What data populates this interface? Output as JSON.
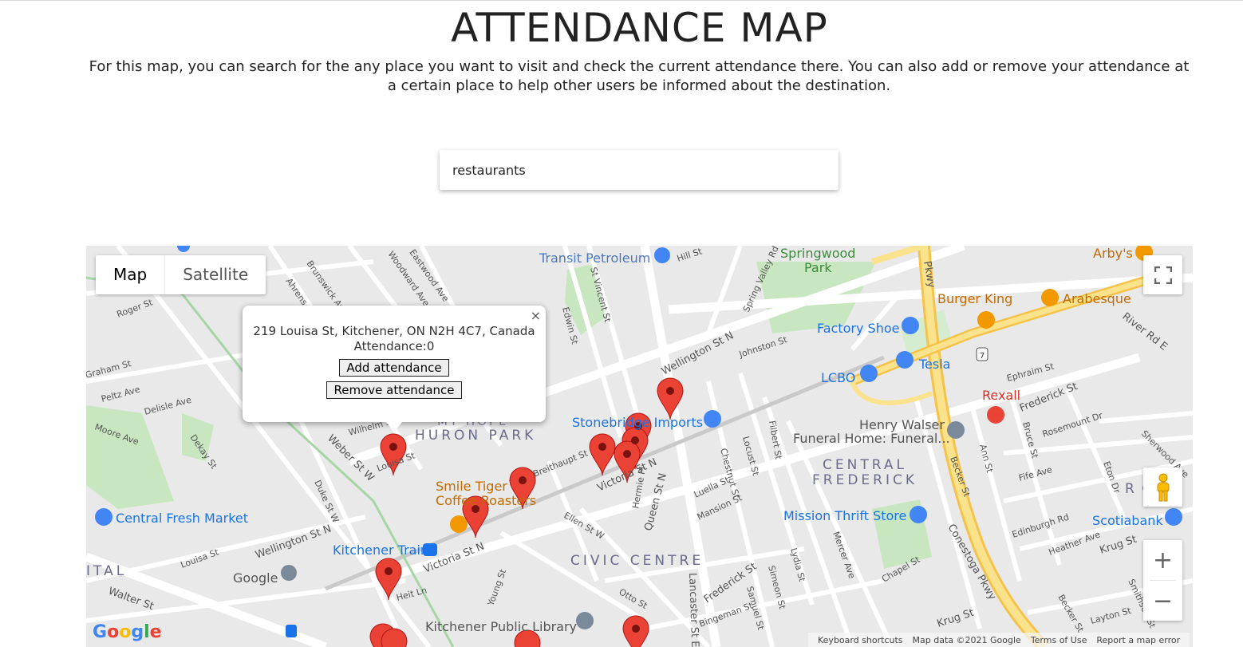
{
  "page": {
    "title": "ATTENDANCE MAP",
    "intro": "For this map, you can search for the any place you want to visit and check the current attendance there. You can also add or remove your attendance at a certain place to help other users be informed about the destination."
  },
  "search": {
    "value": "restaurants"
  },
  "map": {
    "type_control": {
      "map": "Map",
      "satellite": "Satellite"
    },
    "zoom": {
      "in": "+",
      "out": "−"
    },
    "infowindow": {
      "address": "219 Louisa St, Kitchener, ON N2H 4C7, Canada",
      "attendance": "Attendance:0",
      "add_button": "Add attendance",
      "remove_button": "Remove attendance",
      "close": "×"
    },
    "places": {
      "transit_petroleum": "Transit Petroleum",
      "springwood_park_1": "Springwood",
      "springwood_park_2": "Park",
      "arbys": "Arby's",
      "burger_king": "Burger King",
      "arabesque": "Arabesque",
      "factory_shoe": "Factory Shoe",
      "tesla": "Tesla",
      "lcbo": "LCBO",
      "rexall": "Rexall",
      "stonebridge_imports": "Stonebridge Imports",
      "henry_walser_1": "Henry Walser",
      "henry_walser_2": "Funeral Home: Funeral...",
      "central_frederick_1": "CENTRAL",
      "central_frederick_2": "FREDERICK",
      "smile_tiger_1": "Smile Tiger",
      "smile_tiger_2": "Coffee Roasters",
      "central_fresh_market": "Central Fresh Market",
      "mission_thrift": "Mission Thrift Store",
      "scotiabank": "Scotiabank",
      "kitchener_train": "Kitchener Train",
      "google_pin": "Google",
      "civic_centre": "CIVIC CENTRE",
      "huron_park": "HURON PARK",
      "my_hope": "MY HOPE",
      "kitchener_library": "Kitchener Public Library",
      "ital": "ITAL",
      "rom": "R O M"
    },
    "streets": {
      "wellington_n": "Wellington St N",
      "wellington_n2": "Wellington St N",
      "weber_w": "Weber St W",
      "victoria_n": "Victoria St N",
      "victoria_n2": "Victoria St N",
      "queen_n": "Queen St N",
      "lancaster_e": "Lancaster St E",
      "frederick": "Frederick St",
      "frederick2": "Frederick St",
      "conestoga": "Conestoga Pkwy",
      "river_rd": "River Rd E",
      "krug": "Krug St",
      "krug2": "Krug St",
      "walter": "Walter St",
      "louisa": "Louisa St",
      "louisa2": "Louisa St",
      "breithaupt": "Breithaupt St",
      "edwin": "Edwin St",
      "st_vincent": "St Vincent St",
      "rogers": "Roger St",
      "moore": "Moore Ave",
      "duke": "Duke St W",
      "ellen": "Ellen St W",
      "mansion": "Mansion St",
      "luella": "Luella St",
      "chestnut": "Chestnut St",
      "locust": "Locust St",
      "young": "Young St",
      "otto": "Otto St",
      "chapel": "Chapel St",
      "heather": "Heather Ave",
      "fife": "Fife Ave",
      "rosemount": "Rosemount Dr",
      "ephraim": "Ephraim St",
      "johnston": "Johnston St",
      "hill": "Hill St",
      "heit": "Heit Ln",
      "hermie": "Hermie Pl",
      "edinburgh": "Edinburgh Rd",
      "bingeman": "Bingeman St",
      "graham": "Graham St",
      "peltz": "Peltz Ave",
      "delisle": "Delisle Ave",
      "dekay": "Dekay St",
      "wilhelm": "Wilhelm St",
      "brunswick": "Brunswick Ave",
      "ahrens": "Ahrens St W",
      "woodward": "Woodward Ave",
      "eastwood": "Eastwood Ave",
      "spring_valley": "Spring Valley Rd",
      "filbert": "Filbert St",
      "simeon": "Simeon St",
      "lydia": "Lydia St",
      "samuel": "Samuel St",
      "mercer": "Mercer Ave",
      "becker": "Becker St",
      "becker2": "Becker St",
      "ann": "Ann St",
      "bruce": "Bruce St",
      "eton": "Eton Dr",
      "sherwood": "Sherwood Ave",
      "layton": "Layton St",
      "smithson": "Smithson St",
      "highway7": "7",
      "pkwy": "Pkwy"
    },
    "footer": {
      "keyboard": "Keyboard shortcuts",
      "data": "Map data ©2021 Google",
      "terms": "Terms of Use",
      "report": "Report a map error"
    },
    "logo": {
      "g1": "G",
      "o1": "o",
      "o2": "o",
      "g2": "g",
      "l": "l",
      "e": "e"
    },
    "colors": {
      "pin": "#ea4335",
      "park": "#c8e6c0",
      "road": "#ffffff",
      "highway": "#f9d66b",
      "poi_blue": "#4285f4",
      "poi_orange": "#f29900",
      "poi_text_blue": "#1a73e8"
    }
  }
}
